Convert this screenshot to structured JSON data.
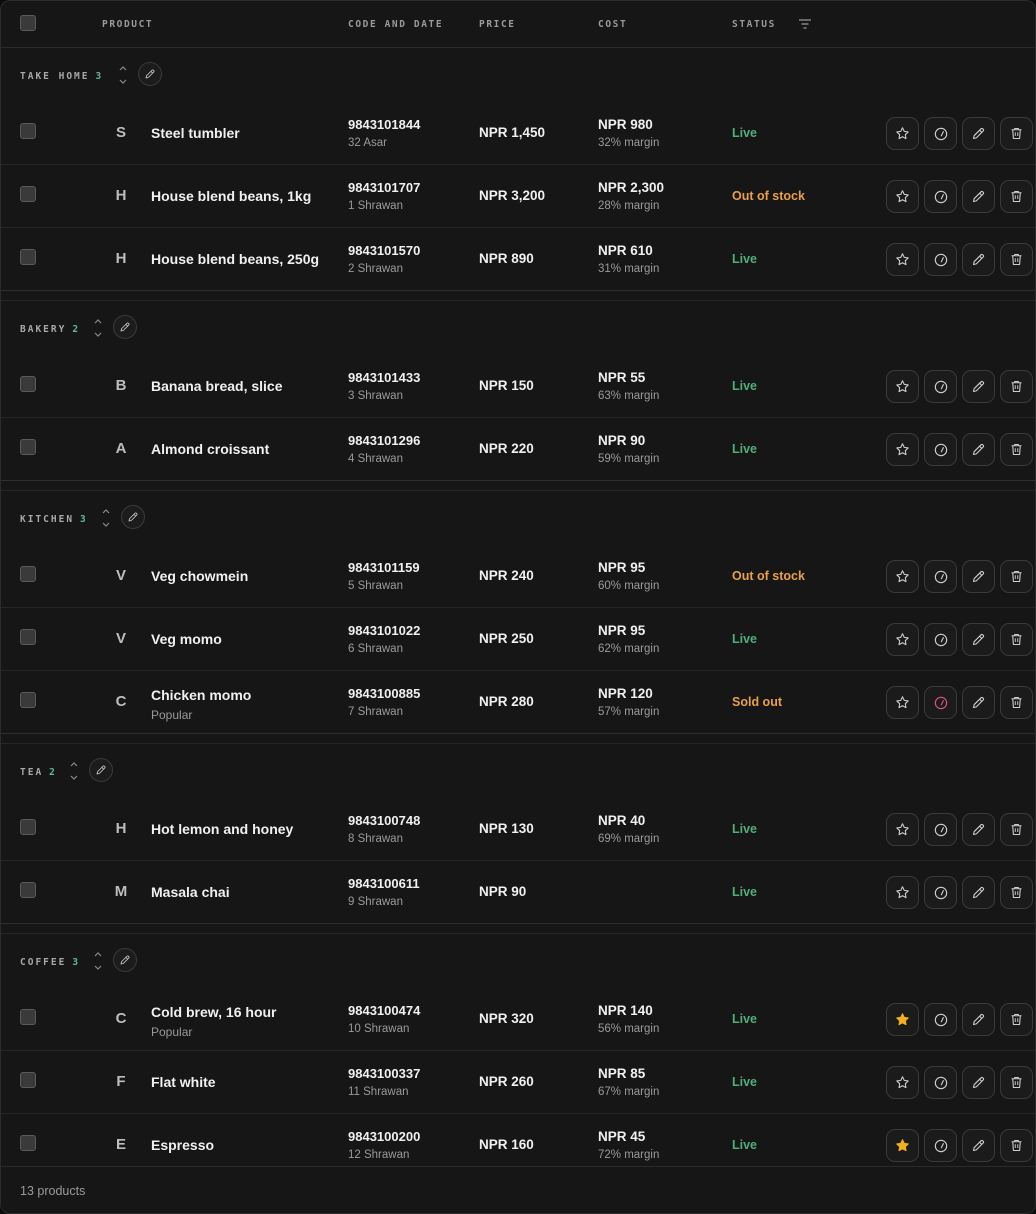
{
  "header": {
    "product": "PRODUCT",
    "code_and_date": "CODE AND DATE",
    "price": "PRICE",
    "cost": "COST",
    "status": "STATUS"
  },
  "colors": {
    "live": "#4fae7a",
    "out_of_stock": "#e9a04a",
    "star_active": "#f2b01e",
    "count_accent": "#5fb8a0",
    "avail_alert": "#e0557a"
  },
  "groups": [
    {
      "name": "TAKE HOME",
      "count": "3",
      "rows": [
        {
          "initial": "S",
          "name": "Steel tumbler",
          "sub": "",
          "code": "9843101844",
          "date": "32 Asar",
          "price": "NPR 1,450",
          "cost": "NPR 980",
          "margin": "32% margin",
          "status": "Live",
          "status_type": "live",
          "starred": false,
          "avail_alert": false
        },
        {
          "initial": "H",
          "name": "House blend beans, 1kg",
          "sub": "",
          "code": "9843101707",
          "date": "1 Shrawan",
          "price": "NPR 3,200",
          "cost": "NPR 2,300",
          "margin": "28% margin",
          "status": "Out of stock",
          "status_type": "oos",
          "starred": false,
          "avail_alert": false
        },
        {
          "initial": "H",
          "name": "House blend beans, 250g",
          "sub": "",
          "code": "9843101570",
          "date": "2 Shrawan",
          "price": "NPR 890",
          "cost": "NPR 610",
          "margin": "31% margin",
          "status": "Live",
          "status_type": "live",
          "starred": false,
          "avail_alert": false
        }
      ]
    },
    {
      "name": "BAKERY",
      "count": "2",
      "rows": [
        {
          "initial": "B",
          "name": "Banana bread, slice",
          "sub": "",
          "code": "9843101433",
          "date": "3 Shrawan",
          "price": "NPR 150",
          "cost": "NPR 55",
          "margin": "63% margin",
          "status": "Live",
          "status_type": "live",
          "starred": false,
          "avail_alert": false
        },
        {
          "initial": "A",
          "name": "Almond croissant",
          "sub": "",
          "code": "9843101296",
          "date": "4 Shrawan",
          "price": "NPR 220",
          "cost": "NPR 90",
          "margin": "59% margin",
          "status": "Live",
          "status_type": "live",
          "starred": false,
          "avail_alert": false
        }
      ]
    },
    {
      "name": "KITCHEN",
      "count": "3",
      "rows": [
        {
          "initial": "V",
          "name": "Veg chowmein",
          "sub": "",
          "code": "9843101159",
          "date": "5 Shrawan",
          "price": "NPR 240",
          "cost": "NPR 95",
          "margin": "60% margin",
          "status": "Out of stock",
          "status_type": "oos",
          "starred": false,
          "avail_alert": false
        },
        {
          "initial": "V",
          "name": "Veg momo",
          "sub": "",
          "code": "9843101022",
          "date": "6 Shrawan",
          "price": "NPR 250",
          "cost": "NPR 95",
          "margin": "62% margin",
          "status": "Live",
          "status_type": "live",
          "starred": false,
          "avail_alert": false
        },
        {
          "initial": "C",
          "name": "Chicken momo",
          "sub": "Popular",
          "code": "9843100885",
          "date": "7 Shrawan",
          "price": "NPR 280",
          "cost": "NPR 120",
          "margin": "57% margin",
          "status": "Sold out",
          "status_type": "oos",
          "starred": false,
          "avail_alert": true
        }
      ]
    },
    {
      "name": "TEA",
      "count": "2",
      "rows": [
        {
          "initial": "H",
          "name": "Hot lemon and honey",
          "sub": "",
          "code": "9843100748",
          "date": "8 Shrawan",
          "price": "NPR 130",
          "cost": "NPR 40",
          "margin": "69% margin",
          "status": "Live",
          "status_type": "live",
          "starred": false,
          "avail_alert": false
        },
        {
          "initial": "M",
          "name": "Masala chai",
          "sub": "",
          "code": "9843100611",
          "date": "9 Shrawan",
          "price": "NPR 90",
          "cost": "",
          "margin": "",
          "status": "Live",
          "status_type": "live",
          "starred": false,
          "avail_alert": false
        }
      ]
    },
    {
      "name": "COFFEE",
      "count": "3",
      "rows": [
        {
          "initial": "C",
          "name": "Cold brew, 16 hour",
          "sub": "Popular",
          "code": "9843100474",
          "date": "10 Shrawan",
          "price": "NPR 320",
          "cost": "NPR 140",
          "margin": "56% margin",
          "status": "Live",
          "status_type": "live",
          "starred": true,
          "avail_alert": false
        },
        {
          "initial": "F",
          "name": "Flat white",
          "sub": "",
          "code": "9843100337",
          "date": "11 Shrawan",
          "price": "NPR 260",
          "cost": "NPR 85",
          "margin": "67% margin",
          "status": "Live",
          "status_type": "live",
          "starred": false,
          "avail_alert": false
        },
        {
          "initial": "E",
          "name": "Espresso",
          "sub": "",
          "code": "9843100200",
          "date": "12 Shrawan",
          "price": "NPR 160",
          "cost": "NPR 45",
          "margin": "72% margin",
          "status": "Live",
          "status_type": "live",
          "starred": true,
          "avail_alert": false
        }
      ]
    }
  ],
  "footer": {
    "count_label": "13 products"
  }
}
